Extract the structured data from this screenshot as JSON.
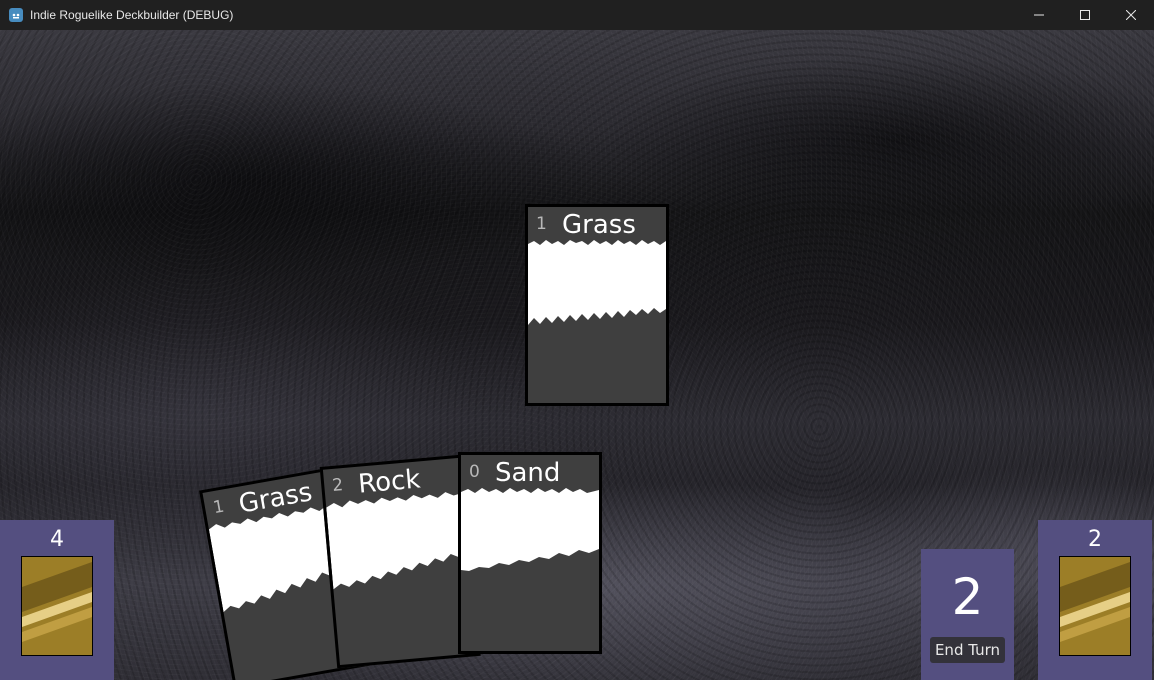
{
  "window": {
    "title": "Indie Roguelike Deckbuilder (DEBUG)",
    "icon": "godot-icon",
    "controls": [
      "minimize-icon",
      "maximize-icon",
      "close-icon"
    ]
  },
  "played_card": {
    "cost": "1",
    "name": "Grass"
  },
  "hand": [
    {
      "cost": "1",
      "name": "Grass"
    },
    {
      "cost": "2",
      "name": "Rock"
    },
    {
      "cost": "0",
      "name": "Sand"
    }
  ],
  "draw_pile": {
    "count": "4"
  },
  "discard_pile": {
    "count": "2"
  },
  "energy": {
    "value": "2"
  },
  "end_turn": {
    "label": "End Turn"
  },
  "colors": {
    "panel": "#544f80",
    "card_body": "#3f3f3f",
    "card_back": "#b8962e"
  }
}
